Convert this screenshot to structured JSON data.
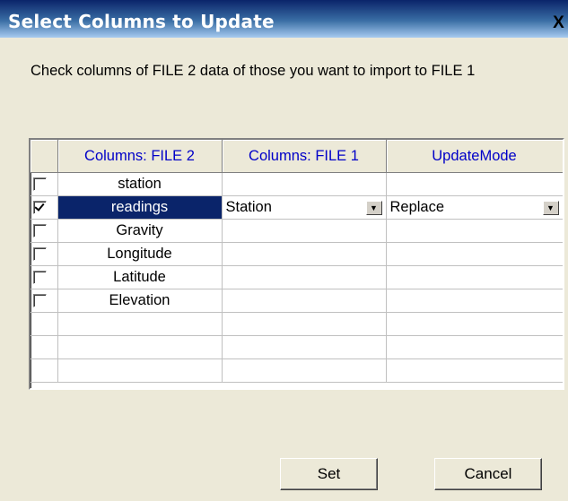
{
  "window": {
    "title": "Select Columns to Update",
    "close_label": "X"
  },
  "instructions": "Check columns of FILE 2 data of those you want to import to FILE 1",
  "grid": {
    "headers": [
      "",
      "Columns: FILE 2",
      "Columns: FILE 1",
      "UpdateMode"
    ],
    "rows": [
      {
        "checked": false,
        "file2": "station",
        "file1": "",
        "mode": ""
      },
      {
        "checked": true,
        "file2": "readings",
        "file1": "Station",
        "mode": "Replace"
      },
      {
        "checked": false,
        "file2": "Gravity",
        "file1": "",
        "mode": ""
      },
      {
        "checked": false,
        "file2": "Longitude",
        "file1": "",
        "mode": ""
      },
      {
        "checked": false,
        "file2": "Latitude",
        "file1": "",
        "mode": ""
      },
      {
        "checked": false,
        "file2": "Elevation",
        "file1": "",
        "mode": ""
      }
    ],
    "empty_rows": 3,
    "selected_row": 1,
    "dropdown_icon": "chevron-down-icon"
  },
  "buttons": {
    "set_label": "Set",
    "cancel_label": "Cancel"
  },
  "colors": {
    "title_start": "#0a246a",
    "title_end": "#a6caf0",
    "header_text": "#0000c8",
    "selection": "#0a246a"
  }
}
